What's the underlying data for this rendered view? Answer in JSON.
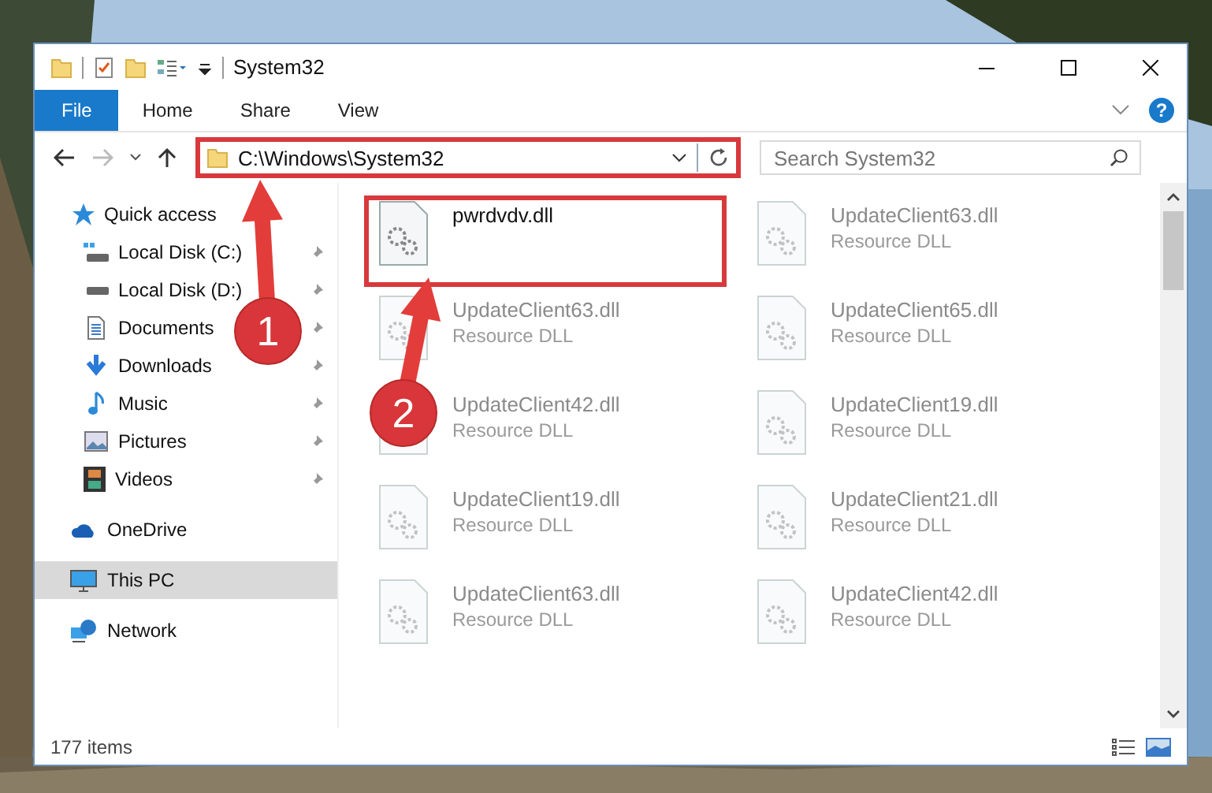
{
  "window": {
    "title": "System32"
  },
  "ribbon": {
    "tabs": [
      {
        "label": "File",
        "selected": true
      },
      {
        "label": "Home",
        "selected": false
      },
      {
        "label": "Share",
        "selected": false
      },
      {
        "label": "View",
        "selected": false
      }
    ],
    "help": "?"
  },
  "address": {
    "path": "C:\\Windows\\System32",
    "highlighted": true
  },
  "search": {
    "placeholder": "Search System32"
  },
  "sidebar": {
    "items": [
      {
        "label": "Quick access",
        "selected": false,
        "children": [
          {
            "label": "Local Disk (C:)",
            "pinned": true
          },
          {
            "label": "Local Disk (D:)",
            "pinned": true
          },
          {
            "label": "Documents",
            "pinned": true
          },
          {
            "label": "Downloads",
            "pinned": true
          },
          {
            "label": "Music",
            "pinned": true
          },
          {
            "label": "Pictures",
            "pinned": true
          },
          {
            "label": "Videos",
            "pinned": true
          }
        ]
      },
      {
        "label": "OneDrive",
        "selected": false
      },
      {
        "label": "This PC",
        "selected": true
      },
      {
        "label": "Network",
        "selected": false
      }
    ]
  },
  "files": [
    {
      "name": "pwrdvdv.dll",
      "blurred": false,
      "highlighted": true
    },
    {
      "name": "UpdateClient63.dll",
      "type": "Resource DLL",
      "blurred": true,
      "highlighted": false
    },
    {
      "name": "UpdateClient63.dll",
      "type": "Resource DLL",
      "blurred": true,
      "highlighted": false
    },
    {
      "name": "UpdateClient65.dll",
      "type": "Resource DLL",
      "blurred": true,
      "highlighted": false
    },
    {
      "name": "UpdateClient42.dll",
      "type": "Resource DLL",
      "blurred": true,
      "highlighted": false
    },
    {
      "name": "UpdateClient19.dll",
      "type": "Resource DLL",
      "blurred": true,
      "highlighted": false
    },
    {
      "name": "UpdateClient19.dll",
      "type": "Resource DLL",
      "blurred": true,
      "highlighted": false
    },
    {
      "name": "UpdateClient21.dll",
      "type": "Resource DLL",
      "blurred": true,
      "highlighted": false
    },
    {
      "name": "UpdateClient63.dll",
      "type": "Resource DLL",
      "blurred": true,
      "highlighted": false
    },
    {
      "name": "UpdateClient42.dll",
      "type": "Resource DLL",
      "blurred": true,
      "highlighted": false
    }
  ],
  "status_bar": {
    "count": "177 items"
  },
  "annotations": [
    {
      "label": "1"
    },
    {
      "label": "2"
    }
  ]
}
